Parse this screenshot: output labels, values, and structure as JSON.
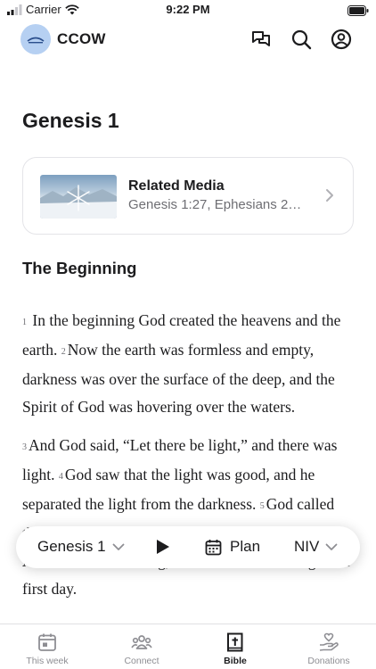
{
  "status_bar": {
    "carrier": "Carrier",
    "time": "9:22 PM"
  },
  "header": {
    "app_title": "CCOW",
    "icons": [
      "messages-icon",
      "search-icon",
      "account-icon"
    ]
  },
  "content": {
    "chapter_title": "Genesis 1",
    "related_media": {
      "title": "Related Media",
      "subtitle": "Genesis 1:27, Ephesians 2…"
    },
    "section_heading": "The Beginning",
    "verses": [
      {
        "num": "1",
        "text": "In the beginning God created the heavens and the earth."
      },
      {
        "num": "2",
        "text": "Now the earth was formless and empty, darkness was over the surface of the deep, and the Spirit of God was hovering over the waters."
      },
      {
        "num": "3",
        "text": "And God said, “Let there be light,” and there was light."
      },
      {
        "num": "4",
        "text": "God saw that the light was good, and he separated the light from the darkness."
      },
      {
        "num": "5",
        "text": "God called the light “day,” and the darkness he called “night.” And there was evening, and there was morning—the first day."
      }
    ]
  },
  "reader_bar": {
    "chapter": "Genesis 1",
    "plan": "Plan",
    "version": "NIV"
  },
  "tab_bar": {
    "tabs": [
      {
        "label": "This week",
        "icon": "calendar-icon",
        "active": false
      },
      {
        "label": "Connect",
        "icon": "people-icon",
        "active": false
      },
      {
        "label": "Bible",
        "icon": "bible-icon",
        "active": true
      },
      {
        "label": "Donations",
        "icon": "donation-hand-icon",
        "active": false
      }
    ]
  },
  "colors": {
    "text": "#1c1c1e",
    "secondary_text": "#6e6e73",
    "logo_bg": "#b6d0f2",
    "inactive_tab": "#8e8e93"
  }
}
